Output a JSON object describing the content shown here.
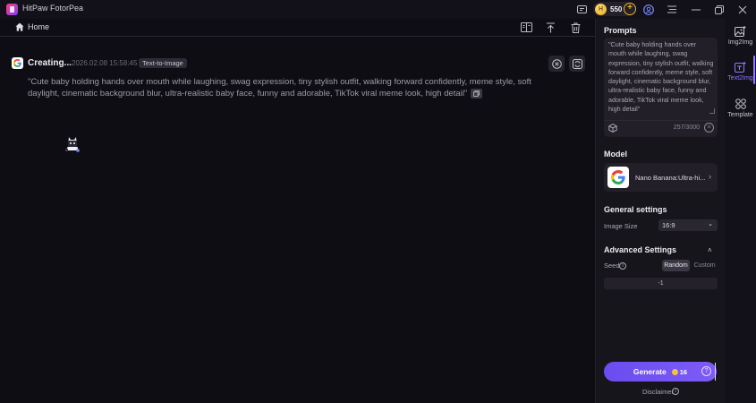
{
  "app": {
    "title": "HitPaw FotorPea",
    "coins": "550",
    "coin_symbol": "H"
  },
  "homebar": {
    "home_label": "Home"
  },
  "task": {
    "status": "Creating...",
    "timestamp": "2026.02.08   15:58:45",
    "tag": "Text-to-Image",
    "prompt": "\"Cute baby holding hands over mouth while laughing, swag expression, tiny stylish outfit, walking forward confidently, meme style, soft daylight, cinematic background blur, ultra-realistic baby face, funny and adorable, TikTok viral meme look, high detail\""
  },
  "panel": {
    "prompts_heading": "Prompts",
    "prompt_value": "\"Cute baby holding hands over mouth while laughing, swag expression, tiny stylish outfit, walking forward confidently, meme style, soft daylight, cinematic background blur, ultra-realistic baby face, funny and adorable, TikTok viral meme look, high detail\"",
    "char_count": "257/3000",
    "model_heading": "Model",
    "model_name": "Nano Banana:Ultra-hi...",
    "general_heading": "General settings",
    "image_size_label": "Image Size",
    "image_size_value": "16:9",
    "advanced_heading": "Advanced Settings",
    "seed_label": "Seed",
    "seed_options": [
      "Random",
      "Custom"
    ],
    "seed_value": "-1",
    "generate_label": "Generate",
    "generate_cost": "16",
    "disclaimer": "Disclaimer"
  },
  "rail": {
    "items": [
      {
        "label": "Img2Img",
        "icon": "image-icon"
      },
      {
        "label": "Text2Img",
        "icon": "text-image-icon"
      },
      {
        "label": "Template",
        "icon": "template-icon"
      }
    ]
  },
  "colors": {
    "accent": "#7d5bf6",
    "background": "#0f0d14",
    "panel": "#17151c",
    "coin": "#e9b41e"
  }
}
